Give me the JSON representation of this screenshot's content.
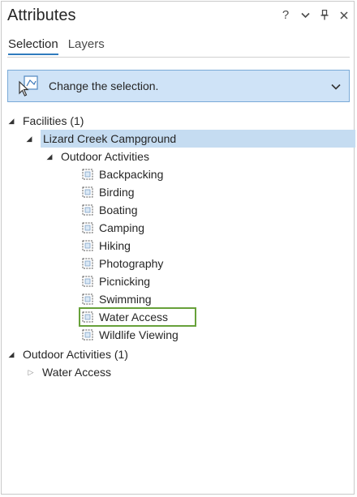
{
  "pane": {
    "title": "Attributes",
    "help_glyph": "?",
    "menu_glyph": "⌄",
    "pin_glyph": "⊥",
    "close_glyph": "×"
  },
  "tabs": [
    {
      "label": "Selection",
      "active": true
    },
    {
      "label": "Layers",
      "active": false
    }
  ],
  "change_selection": {
    "label": "Change the selection.",
    "icon": "select-tool-icon",
    "chevron": "⌄"
  },
  "tree": {
    "facilities": {
      "label": "Facilities (1)"
    },
    "campground": {
      "label": "Lizard Creek Campground"
    },
    "outdoor_group": {
      "label": "Outdoor Activities"
    },
    "activities": [
      {
        "label": "Backpacking"
      },
      {
        "label": "Birding"
      },
      {
        "label": "Boating"
      },
      {
        "label": "Camping"
      },
      {
        "label": "Hiking"
      },
      {
        "label": "Photography"
      },
      {
        "label": "Picnicking"
      },
      {
        "label": "Swimming"
      },
      {
        "label": "Water Access"
      },
      {
        "label": "Wildlife Viewing"
      }
    ],
    "outdoor_activities": {
      "label": "Outdoor Activities (1)"
    },
    "water_access": {
      "label": "Water Access"
    }
  },
  "colors": {
    "accent": "#2f7bbd",
    "selection_fill": "#c5dcf1",
    "highlight_outline": "#67a13a"
  }
}
